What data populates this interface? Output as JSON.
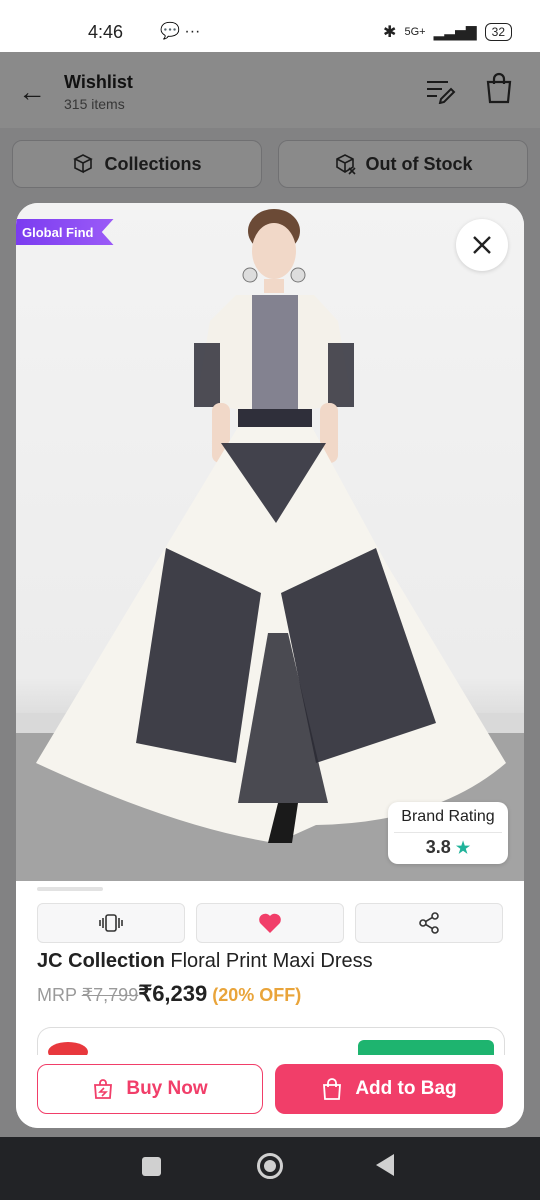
{
  "status": {
    "time": "4:46",
    "battery": "32",
    "network": "5G+"
  },
  "header": {
    "title": "Wishlist",
    "item_count": "315 items"
  },
  "tabs": [
    {
      "label": "Collections"
    },
    {
      "label": "Out of Stock"
    }
  ],
  "card": {
    "badge": "Global Find",
    "rating": {
      "label": "Brand Rating",
      "value": "3.8",
      "star": "★"
    },
    "brand": "JC Collection",
    "product_name": "Floral Print Maxi Dress",
    "price": {
      "mrp_label": "MRP",
      "mrp": "₹7,799",
      "current": "₹6,239",
      "discount": "(20% OFF)"
    },
    "buttons": {
      "buy_now": "Buy Now",
      "add_to_bag": "Add to Bag"
    }
  },
  "colors": {
    "accent": "#f13e69",
    "badge": "#7b3cf0",
    "rating_star": "#20b39a",
    "discount": "#e9a43a"
  },
  "icons": [
    "back-arrow-icon",
    "edit-list-icon",
    "bag-icon",
    "collections-icon",
    "out-of-stock-icon",
    "close-icon",
    "similar-icon",
    "heart-icon",
    "share-icon",
    "buy-now-icon",
    "bag-icon"
  ]
}
